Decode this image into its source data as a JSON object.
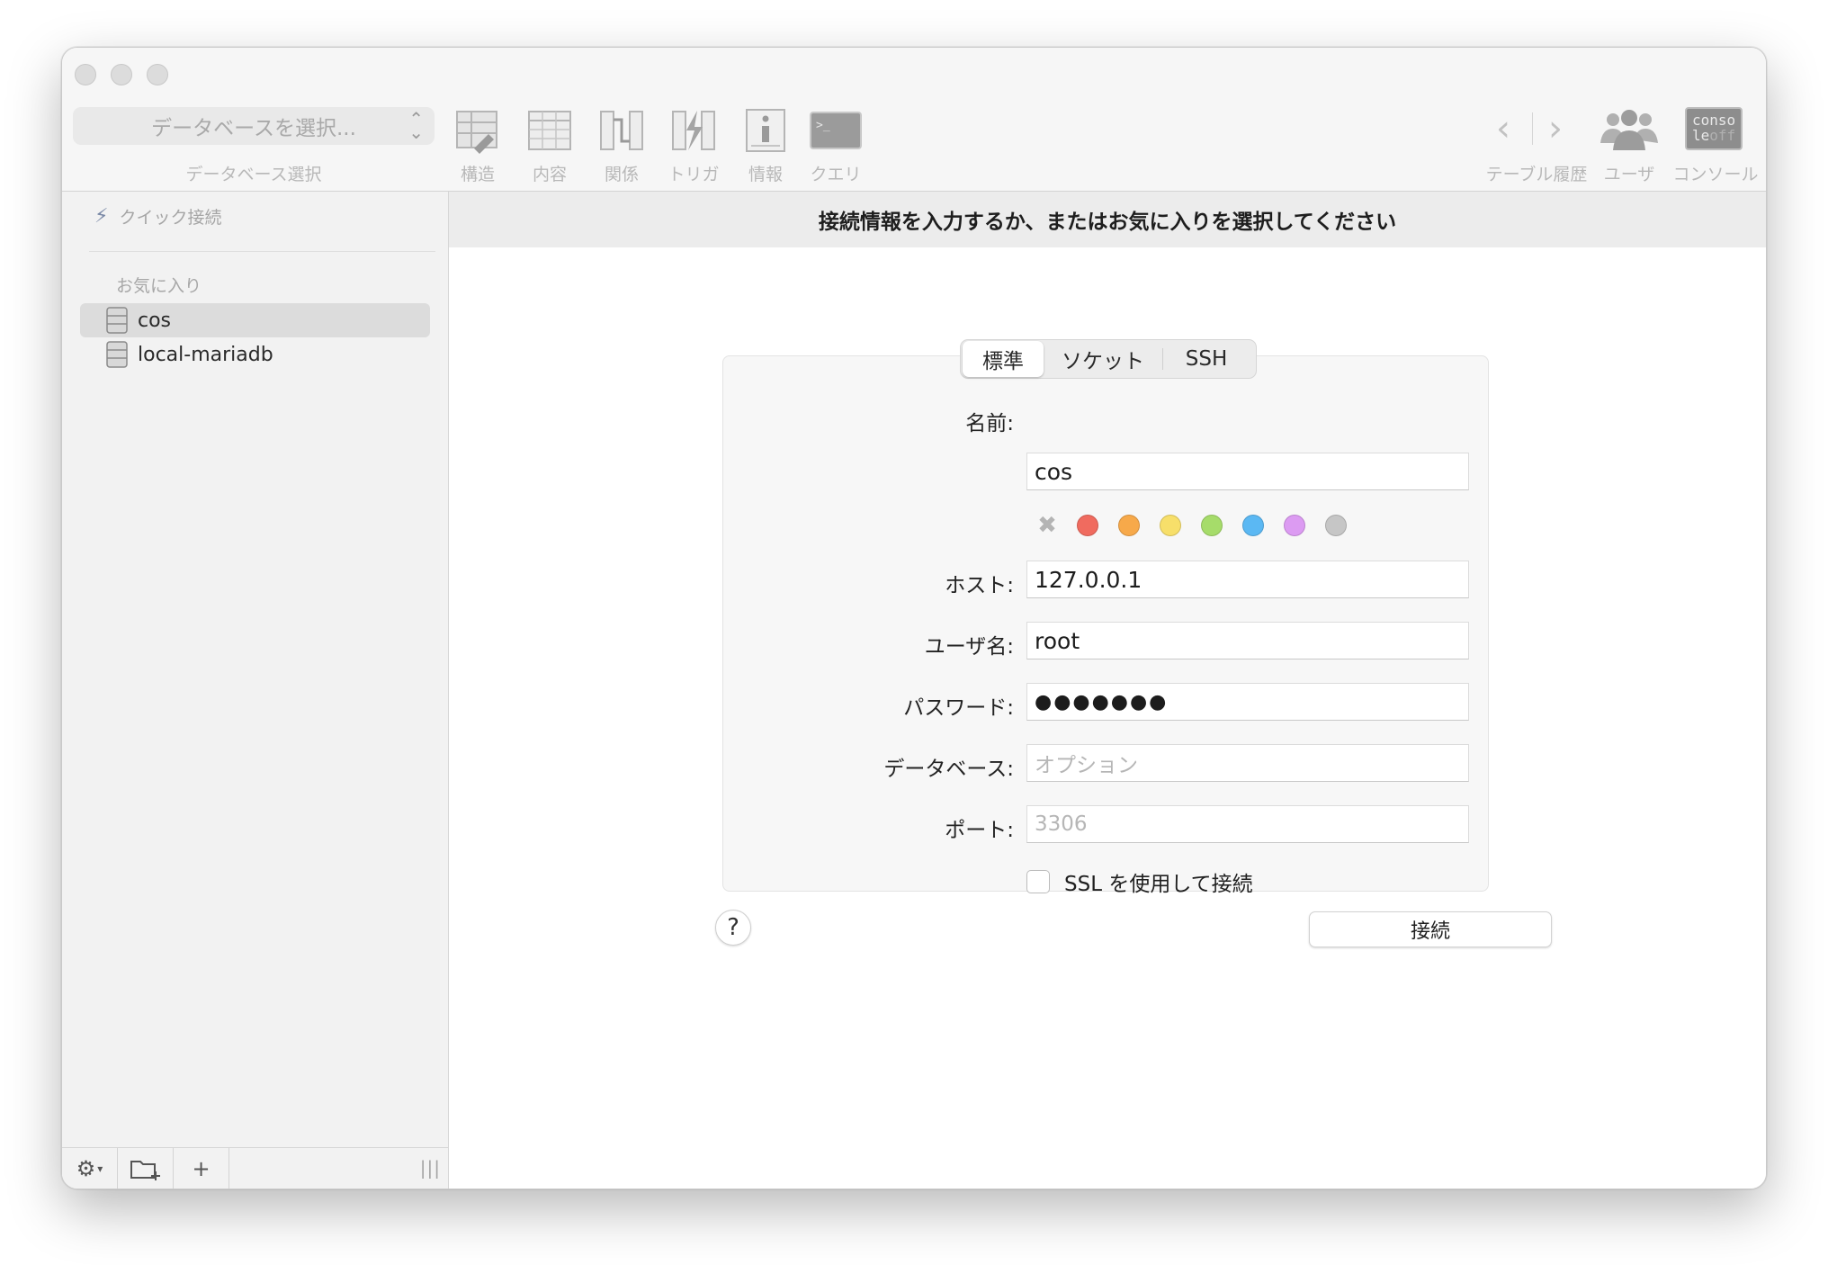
{
  "toolbar": {
    "db_select_placeholder": "データベースを選択...",
    "db_select_label": "データベース選択",
    "tools": [
      {
        "label": "構造",
        "icon": "structure-icon"
      },
      {
        "label": "内容",
        "icon": "content-table-icon"
      },
      {
        "label": "関係",
        "icon": "relations-icon"
      },
      {
        "label": "トリガ",
        "icon": "triggers-icon"
      },
      {
        "label": "情報",
        "icon": "info-icon"
      },
      {
        "label": "クエリ",
        "icon": "query-terminal-icon"
      }
    ],
    "history_label": "テーブル履歴",
    "users_label": "ユーザ",
    "console_label": "コンソール",
    "console_icon_line1": "conso",
    "console_icon_line2a": "le",
    "console_icon_line2b": "off"
  },
  "sidebar": {
    "quick_connect": "クイック接続",
    "favorites_title": "お気に入り",
    "favorites": [
      {
        "name": "cos",
        "selected": true
      },
      {
        "name": "local-mariadb",
        "selected": false
      }
    ],
    "grip": "|||"
  },
  "main": {
    "banner": "接続情報を入力するか、またはお気に入りを選択してください",
    "tabs": [
      "標準",
      "ソケット",
      "SSH"
    ],
    "active_tab": "標準",
    "fields": {
      "name_label": "名前:",
      "name_value": "cos",
      "host_label": "ホスト:",
      "host_value": "127.0.0.1",
      "user_label": "ユーザ名:",
      "user_value": "root",
      "password_label": "パスワード:",
      "password_value": "●●●●●●●",
      "database_label": "データベース:",
      "database_placeholder": "オプション",
      "port_label": "ポート:",
      "port_placeholder": "3306"
    },
    "color_swatches": [
      "#f06b5f",
      "#f7a94a",
      "#f7df6a",
      "#a6dc6a",
      "#5bb8f3",
      "#dc9bf2",
      "#c6c6c6"
    ],
    "ssl_label": "SSL を使用して接続",
    "ssl_checked": false,
    "help_label": "?",
    "connect_label": "接続"
  }
}
